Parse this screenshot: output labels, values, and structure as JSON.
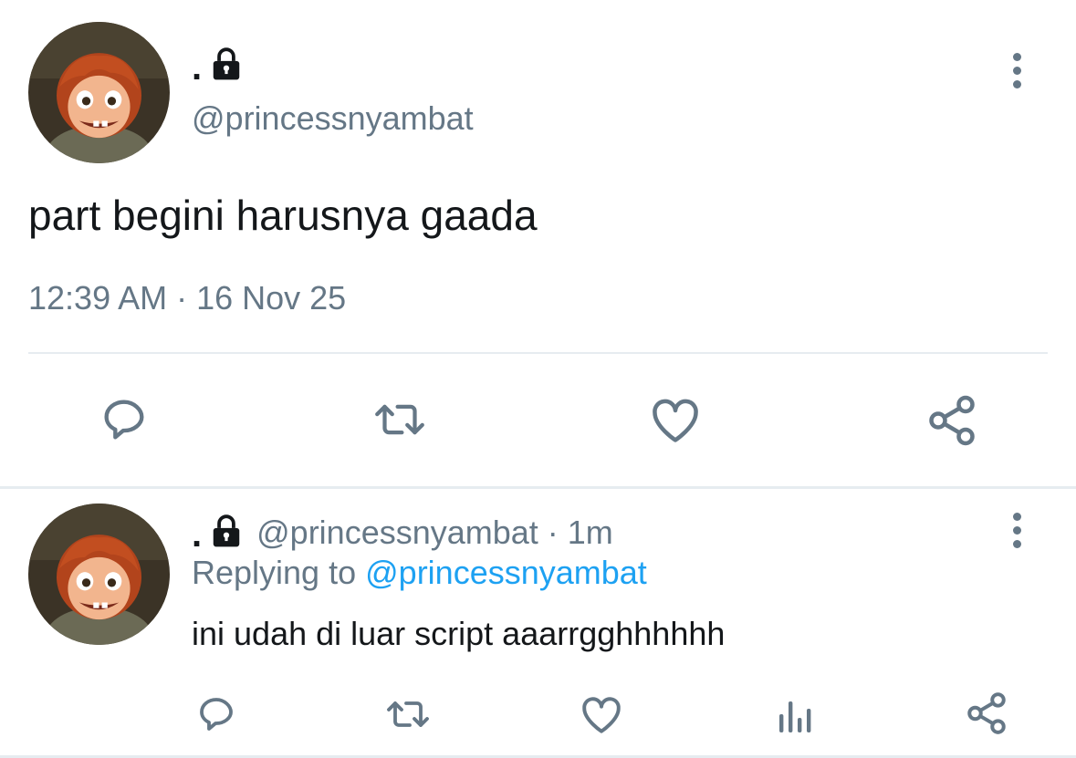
{
  "colors": {
    "text_primary": "#14171a",
    "text_secondary": "#657786",
    "link": "#1da1f2",
    "divider": "#e6ecf0"
  },
  "main_tweet": {
    "author_name": ".",
    "author_locked_icon": "lock-icon",
    "author_handle": "@princessnyambat",
    "text": "part begini harusnya gaada",
    "timestamp": "12:39 AM · 16 Nov 25",
    "actions": [
      "reply-icon",
      "retweet-icon",
      "like-icon",
      "share-icon"
    ],
    "menu_icon": "more-vertical-icon"
  },
  "reply_tweet": {
    "author_name": ".",
    "author_locked_icon": "lock-icon",
    "author_handle_time": "@princessnyambat · 1m",
    "replying_prefix": "Replying to",
    "replying_to": "@princessnyambat",
    "text": "ini udah di luar script aaarrgghhhhhh",
    "actions": [
      "reply-icon",
      "retweet-icon",
      "like-icon",
      "analytics-icon",
      "share-icon"
    ],
    "menu_icon": "more-vertical-icon"
  }
}
